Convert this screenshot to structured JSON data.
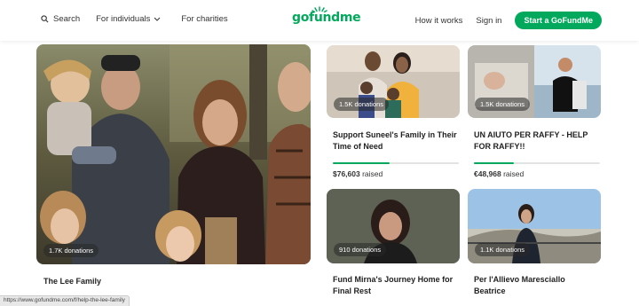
{
  "nav": {
    "search": "Search",
    "individuals": "For individuals",
    "charities": "For charities",
    "how_it_works": "How it works",
    "sign_in": "Sign in",
    "start": "Start a GoFundMe"
  },
  "logo": "gofundme",
  "colors": {
    "brand": "#02a95c"
  },
  "featured": {
    "donations": "1.7K donations",
    "title": "The Lee Family"
  },
  "cards": [
    {
      "donations": "1.5K donations",
      "title": "Support Suneel's Family in Their Time of Need",
      "raised_amount": "$76,603",
      "raised_suffix": " raised",
      "progress": 0.45
    },
    {
      "donations": "1.5K donations",
      "title": "UN AIUTO PER RAFFY - HELP FOR RAFFY!!",
      "raised_amount": "€48,968",
      "raised_suffix": " raised",
      "progress": 0.32
    },
    {
      "donations": "910 donations",
      "title": "Fund Mirna's Journey Home for Final Rest"
    },
    {
      "donations": "1.1K donations",
      "title": "Per l'Allievo Maresciallo Beatrice"
    }
  ],
  "status_url": "https://www.gofundme.com/f/help-the-lee-family"
}
